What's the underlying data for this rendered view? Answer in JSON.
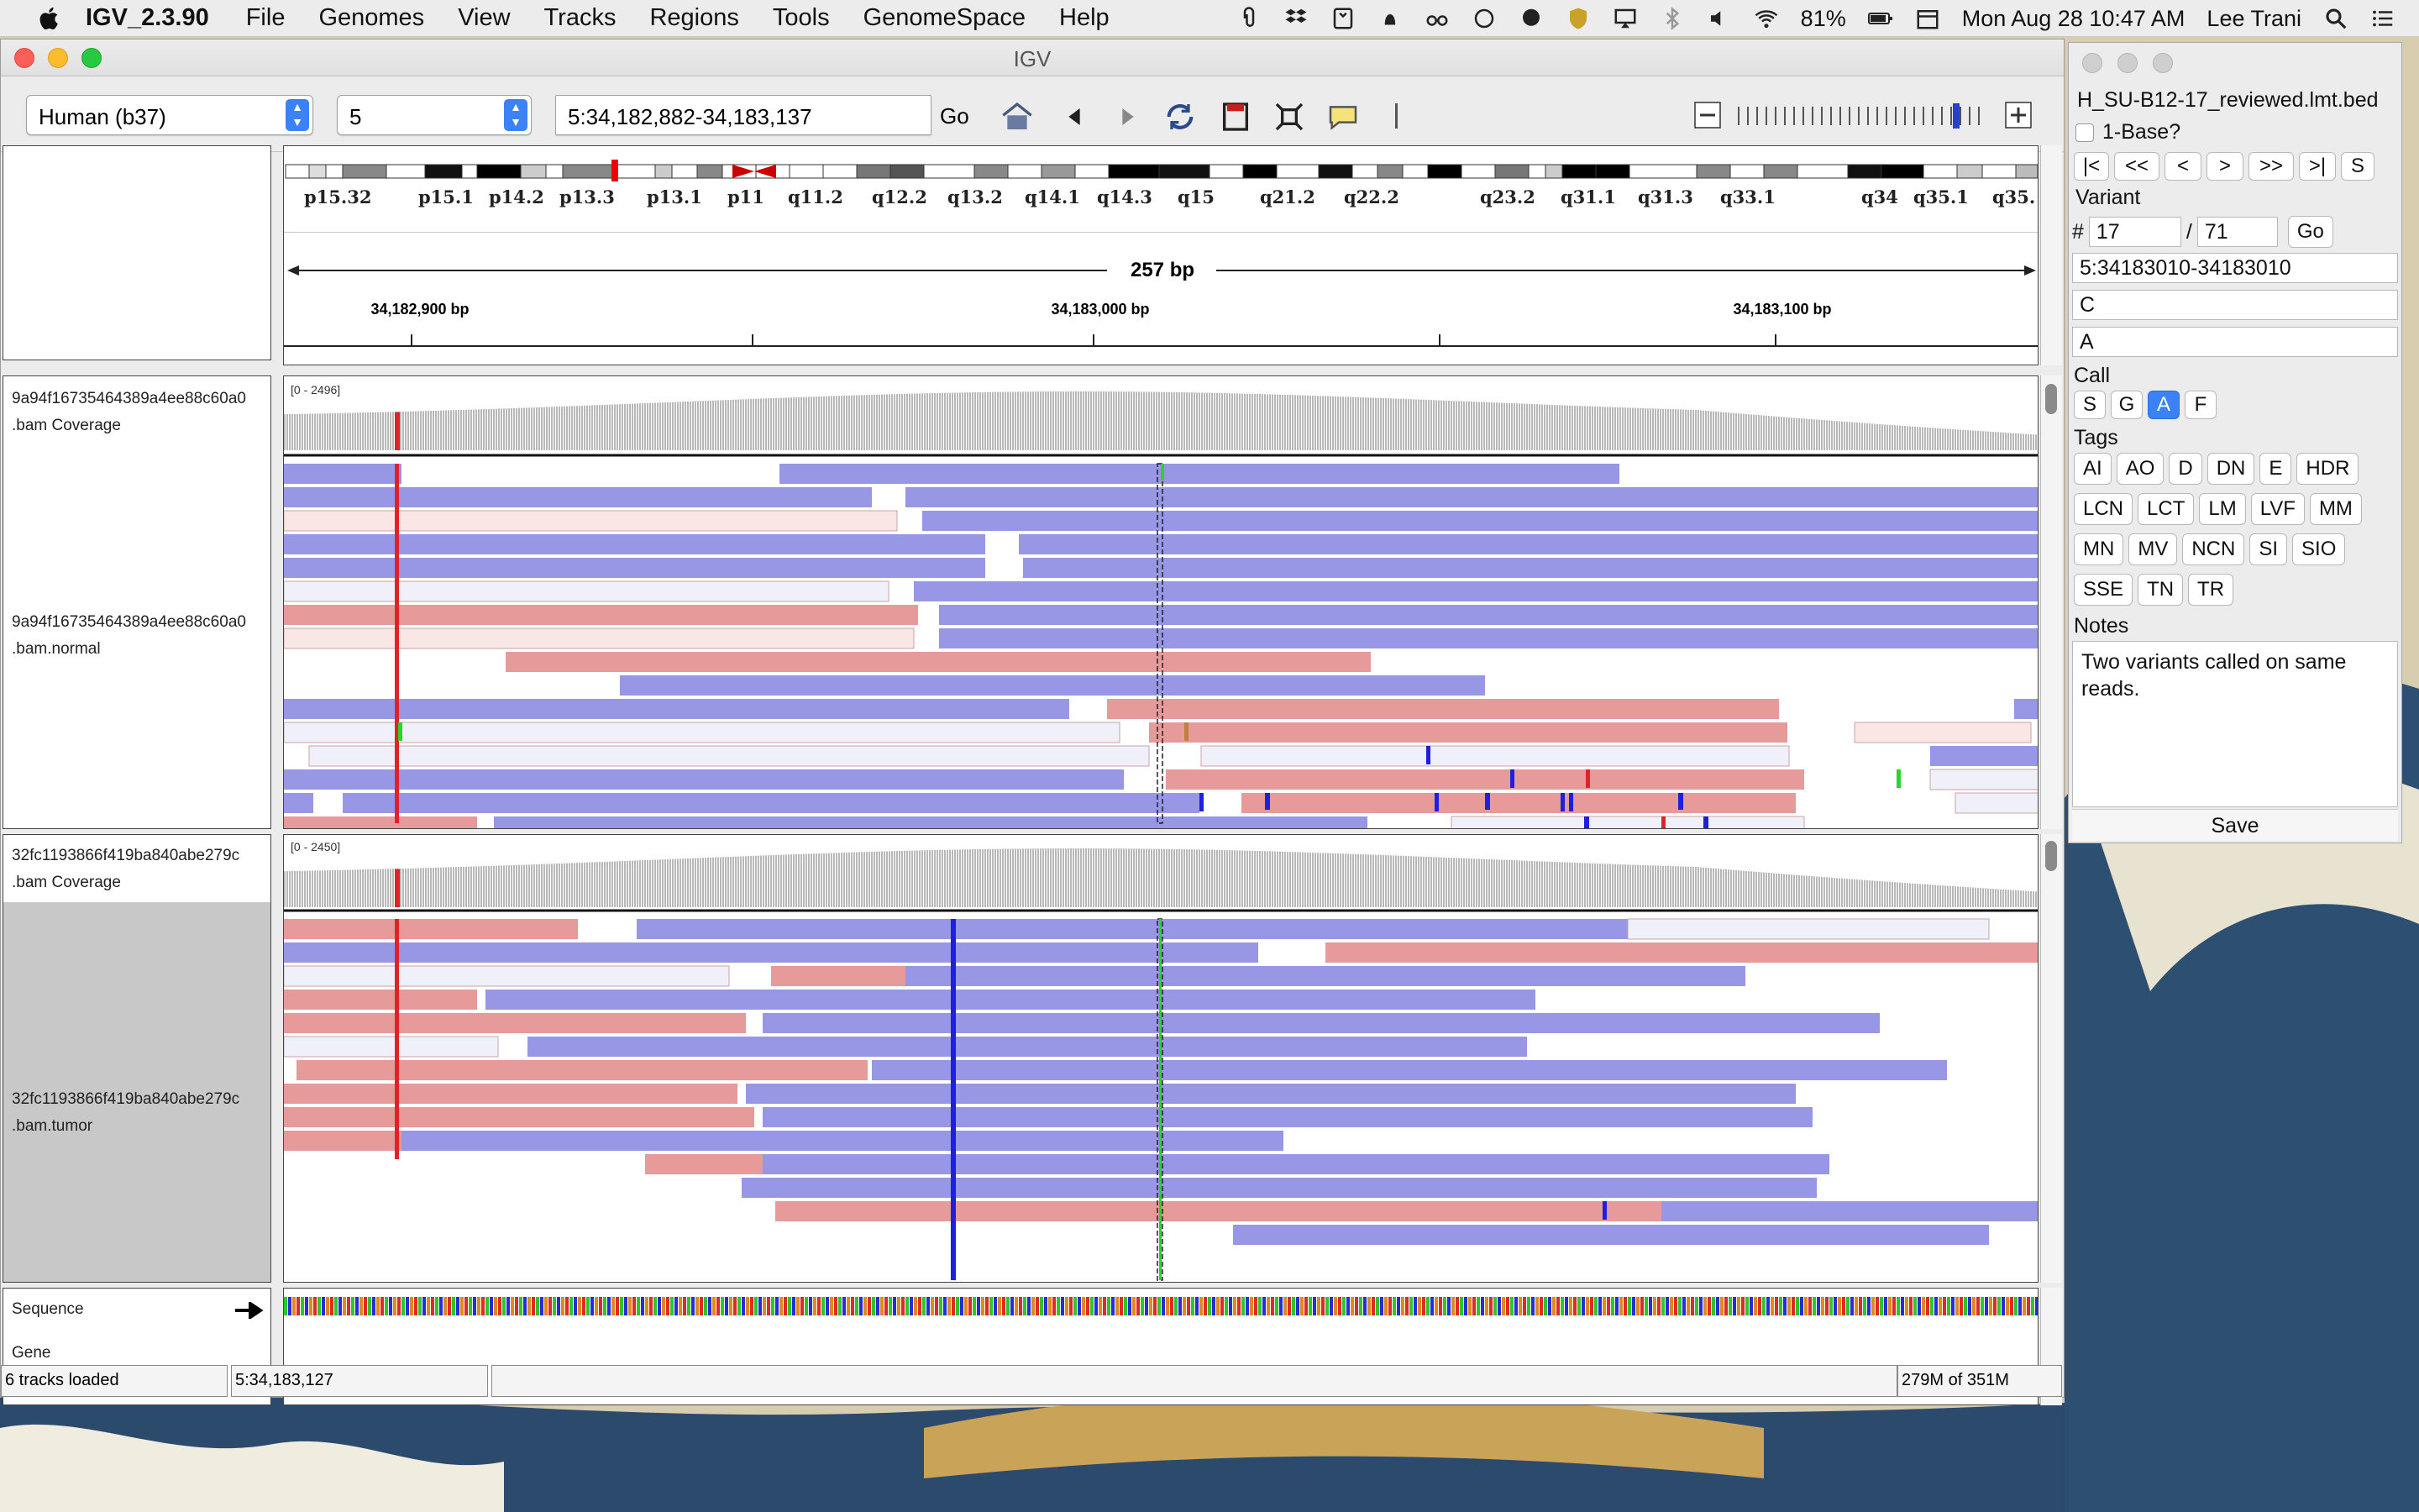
{
  "menubar": {
    "app_name": "IGV_2.3.90",
    "items": [
      "File",
      "Genomes",
      "View",
      "Tracks",
      "Regions",
      "Tools",
      "GenomeSpace",
      "Help"
    ],
    "battery": "81%",
    "datetime": "Mon Aug 28  10:47 AM",
    "user": "Lee Trani"
  },
  "window": {
    "title": "IGV"
  },
  "toolbar": {
    "genome": "Human (b37)",
    "chromosome": "5",
    "locus": "5:34,182,882-34,183,137",
    "go_label": "Go"
  },
  "ideogram": {
    "bands": [
      "p15.32",
      "p15.1",
      "p14.2",
      "p13.3",
      "p13.1",
      "p11",
      "q11.2",
      "q12.2",
      "q13.2",
      "q14.1",
      "q14.3",
      "q15",
      "q21.2",
      "q22.2",
      "q23.2",
      "q31.1",
      "q31.3",
      "q33.1",
      "q34",
      "q35.1",
      "q35."
    ],
    "span_label": "257 bp",
    "ruler_ticks": [
      "34,182,900 bp",
      "34,183,000 bp",
      "34,183,100 bp"
    ]
  },
  "tracks": {
    "normal_coverage": {
      "name": "9a94f16735464389a4ee88c60a0",
      "suffix": ".bam Coverage",
      "range": "[0 - 2496]"
    },
    "normal_reads": {
      "name": "9a94f16735464389a4ee88c60a0",
      "suffix": ".bam.normal"
    },
    "tumor_coverage": {
      "name": "32fc1193866f419ba840abe279c",
      "suffix": ".bam Coverage",
      "range": "[0 - 2450]"
    },
    "tumor_reads": {
      "name": "32fc1193866f419ba840abe279c",
      "suffix": ".bam.tumor"
    },
    "sequence": {
      "name": "Sequence"
    },
    "gene": {
      "name": "Gene"
    }
  },
  "status": {
    "tracks_loaded": "6 tracks loaded",
    "position": "5:34,183,127",
    "memory": "279M of 351M"
  },
  "side_panel": {
    "file": "H_SU-B12-17_reviewed.lmt.bed",
    "one_base": "1-Base?",
    "nav_buttons": [
      "|<",
      "<<",
      "<",
      ">",
      ">>",
      ">|",
      "S"
    ],
    "variant_label": "Variant",
    "hash": "#",
    "variant_index": "17",
    "slash": "/",
    "variant_total": "71",
    "go_label": "Go",
    "locus": "5:34183010-34183010",
    "ref": "C",
    "alt": "A",
    "call_label": "Call",
    "calls": [
      "S",
      "G",
      "A",
      "F"
    ],
    "active_call": "A",
    "tags_label": "Tags",
    "tags": [
      "AI",
      "AO",
      "D",
      "DN",
      "E",
      "HDR",
      "LCN",
      "LCT",
      "LM",
      "LVF",
      "MM",
      "MN",
      "MV",
      "NCN",
      "SI",
      "SIO",
      "SSE",
      "TN",
      "TR"
    ],
    "notes_label": "Notes",
    "notes": "Two variants called on same reads.",
    "save_label": "Save"
  },
  "colors": {
    "forward_read": "#9797e6",
    "reverse_read": "#e79a9a",
    "mismatch_T": "#e0232a",
    "mismatch_C": "#1f1fe0",
    "mismatch_A": "#2ad42a",
    "coverage": "#b8b8b8"
  }
}
